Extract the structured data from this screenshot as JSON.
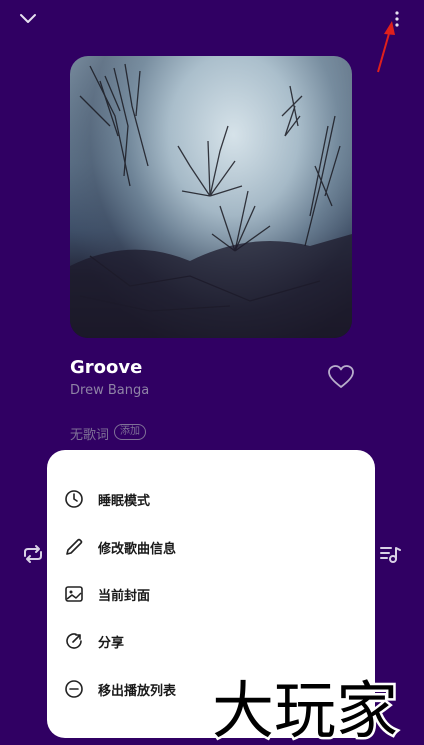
{
  "song": {
    "title": "Groove",
    "artist": "Drew Banga",
    "lyrics_status": "无歌词",
    "add_label": "添加"
  },
  "menu": {
    "items": [
      {
        "label": "睡眠模式",
        "icon": "clock-icon"
      },
      {
        "label": "修改歌曲信息",
        "icon": "pencil-icon"
      },
      {
        "label": "当前封面",
        "icon": "image-icon"
      },
      {
        "label": "分享",
        "icon": "share-icon"
      },
      {
        "label": "移出播放列表",
        "icon": "remove-circle-icon"
      }
    ]
  },
  "watermark": {
    "text": "大玩家"
  },
  "colors": {
    "background": "#300063",
    "menu_background": "#ffffff",
    "annotation_arrow": "#e0201c"
  }
}
